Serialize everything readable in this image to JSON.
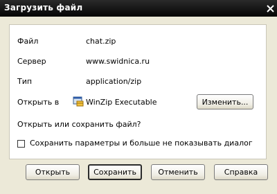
{
  "window": {
    "title": "Загрузить файл"
  },
  "details": {
    "file_label": "Файл",
    "file_value": "chat.zip",
    "server_label": "Сервер",
    "server_value": "www.swidnica.ru",
    "type_label": "Тип",
    "type_value": "application/zip",
    "open_with_label": "Открыть в",
    "open_with_value": "WinZip Executable",
    "open_with_icon": "winzip-icon",
    "change_button": "Изменить...",
    "question": "Открыть или сохранить файл?"
  },
  "remember": {
    "label": "Сохранить параметры и больше не показывать диалог",
    "checked": false
  },
  "buttons": {
    "open": "Открыть",
    "save": "Сохранить",
    "cancel": "Отменить",
    "help": "Справка"
  }
}
